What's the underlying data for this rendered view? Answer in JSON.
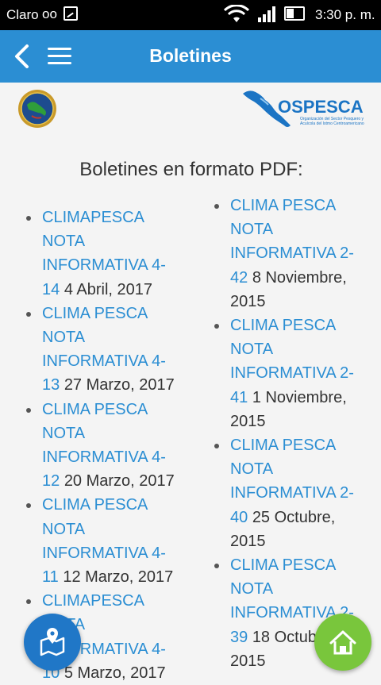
{
  "status_bar": {
    "carrier": "Claro",
    "voicemail": "oo",
    "time": "3:30 p. m."
  },
  "app_bar": {
    "title": "Boletines",
    "back_icon": "chevron-left-icon",
    "menu_icon": "hamburger-icon"
  },
  "logos": {
    "ospesca_name": "OSPESCA",
    "ospesca_tagline": "Organización del Sector Pesquero y Acuícola del Istmo Centroamericano"
  },
  "heading": "Boletines en formato PDF:",
  "left_items": [
    {
      "link": "CLIMAPESCA NOTA INFORMATIVA 4-14",
      "date": "4 Abril, 2017"
    },
    {
      "link": "CLIMA PESCA NOTA INFORMATIVA 4-13",
      "date": "27 Marzo, 2017"
    },
    {
      "link": "CLIMA PESCA NOTA INFORMATIVA 4-12",
      "date": "20 Marzo, 2017"
    },
    {
      "link": "CLIMA PESCA NOTA INFORMATIVA 4-11",
      "date": "12 Marzo, 2017"
    },
    {
      "link": "CLIMAPESCA NOTA INFORMATIVA 4-10",
      "date": "5 Marzo, 2017"
    }
  ],
  "right_items": [
    {
      "link": "CLIMA PESCA NOTA INFORMATIVA 2-42",
      "date": "8 Noviembre, 2015"
    },
    {
      "link": "CLIMA PESCA NOTA INFORMATIVA 2-41",
      "date": "1 Noviembre, 2015"
    },
    {
      "link": "CLIMA PESCA NOTA INFORMATIVA 2-40",
      "date": "25 Octubre, 2015"
    },
    {
      "link": "CLIMA PESCA NOTA INFORMATIVA 2-39",
      "date": "18 Octubre, 2015"
    }
  ],
  "fabs": {
    "map_icon": "map-pin-icon",
    "home_icon": "home-icon"
  },
  "colors": {
    "app_bar": "#2b8ed3",
    "link": "#2b8ed3",
    "fab_map": "#2077c7",
    "fab_home": "#79c63c"
  }
}
